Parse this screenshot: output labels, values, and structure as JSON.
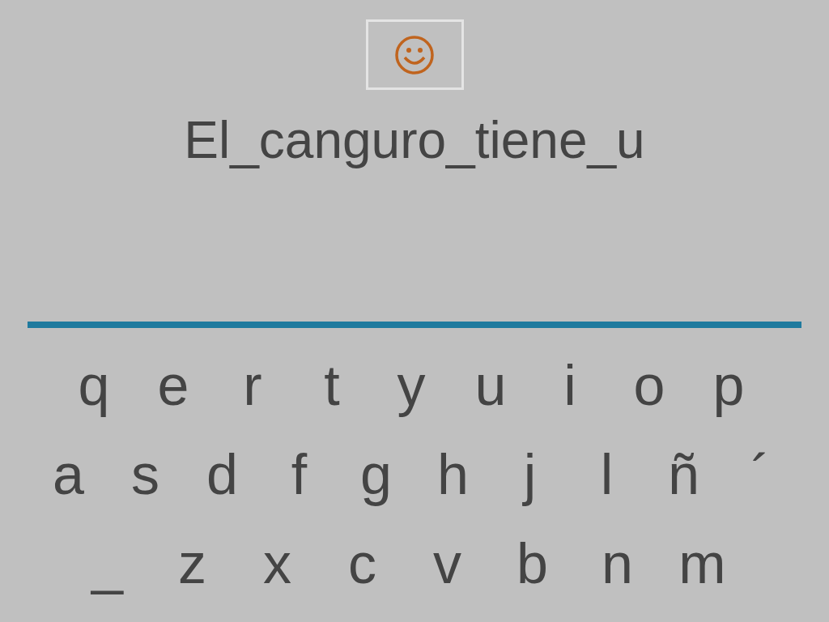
{
  "answer_text": "El_canguro_tiene_u",
  "keyboard": {
    "rows": [
      [
        "q",
        "e",
        "r",
        "t",
        "y",
        "u",
        "i",
        "o",
        "p"
      ],
      [
        "a",
        "s",
        "d",
        "f",
        "g",
        "h",
        "j",
        "l",
        "ñ",
        "´"
      ],
      [
        "_",
        "z",
        "x",
        "c",
        "v",
        "b",
        "n",
        "m"
      ]
    ]
  }
}
